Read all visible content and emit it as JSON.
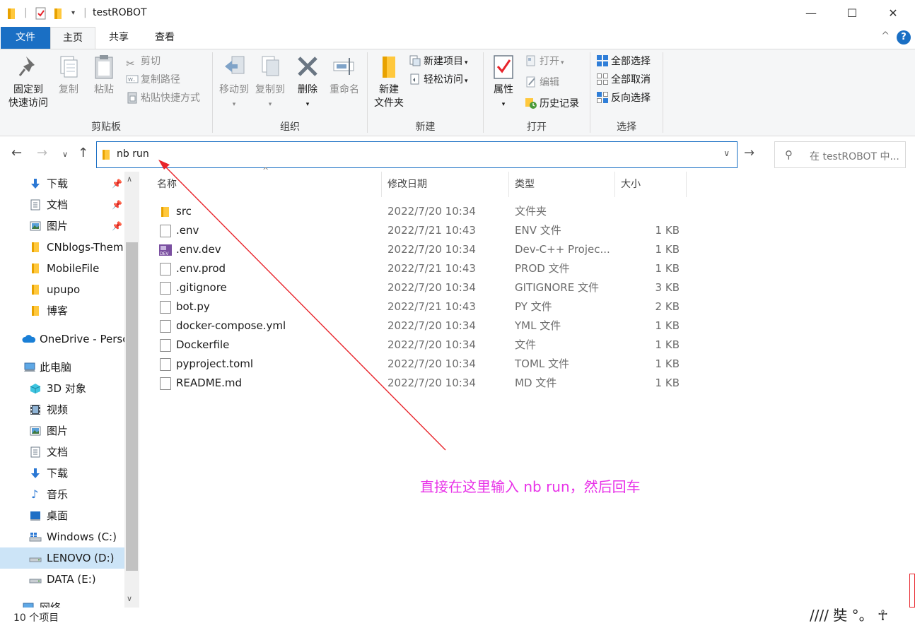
{
  "window": {
    "title": "testROBOT",
    "minimize_glyph": "—",
    "maximize_glyph": "☐",
    "close_glyph": "✕"
  },
  "tabs": [
    {
      "label": "文件"
    },
    {
      "label": "主页"
    },
    {
      "label": "共享"
    },
    {
      "label": "查看"
    }
  ],
  "help_glyph": "?",
  "collapse_glyph": "^",
  "ribbon": {
    "clipboard": {
      "label": "剪贴板",
      "pin_line1": "固定到",
      "pin_line2": "快速访问",
      "copy": "复制",
      "paste": "粘贴",
      "cut": "剪切",
      "copy_path": "复制路径",
      "paste_shortcut": "粘贴快捷方式"
    },
    "organize": {
      "label": "组织",
      "move_to": "移动到",
      "copy_to": "复制到",
      "delete": "删除",
      "rename": "重命名"
    },
    "new": {
      "label": "新建",
      "new_folder_line1": "新建",
      "new_folder_line2": "文件夹",
      "new_item": "新建项目",
      "easy_access": "轻松访问"
    },
    "open": {
      "label": "打开",
      "properties": "属性",
      "open": "打开",
      "edit": "编辑",
      "history": "历史记录"
    },
    "select": {
      "label": "选择",
      "select_all": "全部选择",
      "select_none": "全部取消",
      "invert": "反向选择"
    }
  },
  "address": {
    "path": "nb run",
    "search_placeholder": "在 testROBOT 中..."
  },
  "nav": {
    "items": [
      {
        "label": "下载",
        "pinned": true,
        "icon": "download-icon"
      },
      {
        "label": "文档",
        "pinned": true,
        "icon": "document-icon"
      },
      {
        "label": "图片",
        "pinned": true,
        "icon": "picture-icon"
      },
      {
        "label": "CNblogs-Them",
        "pinned": false,
        "icon": "folder-icon"
      },
      {
        "label": "MobileFile",
        "pinned": false,
        "icon": "folder-icon"
      },
      {
        "label": "upupo",
        "pinned": false,
        "icon": "folder-icon"
      },
      {
        "label": "博客",
        "pinned": false,
        "icon": "folder-icon"
      },
      {
        "label": "OneDrive - Perso",
        "pinned": false,
        "icon": "cloud-icon"
      },
      {
        "label": "此电脑",
        "pinned": false,
        "icon": "computer-icon"
      },
      {
        "label": "3D 对象",
        "pinned": false,
        "icon": "3d-objects-icon"
      },
      {
        "label": "视频",
        "pinned": false,
        "icon": "video-icon"
      },
      {
        "label": "图片",
        "pinned": false,
        "icon": "picture-icon"
      },
      {
        "label": "文档",
        "pinned": false,
        "icon": "document-icon"
      },
      {
        "label": "下载",
        "pinned": false,
        "icon": "download-icon"
      },
      {
        "label": "音乐",
        "pinned": false,
        "icon": "music-icon"
      },
      {
        "label": "桌面",
        "pinned": false,
        "icon": "desktop-icon"
      },
      {
        "label": "Windows (C:)",
        "pinned": false,
        "icon": "drive-icon"
      },
      {
        "label": "LENOVO (D:)",
        "pinned": false,
        "icon": "drive-icon",
        "selected": true
      },
      {
        "label": "DATA (E:)",
        "pinned": false,
        "icon": "drive-icon"
      },
      {
        "label": "网络",
        "pinned": false,
        "icon": "network-icon"
      }
    ],
    "pin_glyph": "📌"
  },
  "columns": {
    "name": "名称",
    "date": "修改日期",
    "type": "类型",
    "size": "大小"
  },
  "files": [
    {
      "name": "src",
      "date": "2022/7/20 10:34",
      "type": "文件夹",
      "size": "",
      "icon": "folder-icon"
    },
    {
      "name": ".env",
      "date": "2022/7/21 10:43",
      "type": "ENV 文件",
      "size": "1 KB",
      "icon": "file-icon"
    },
    {
      "name": ".env.dev",
      "date": "2022/7/20 10:34",
      "type": "Dev-C++ Projec...",
      "size": "1 KB",
      "icon": "dev-cpp-project-icon"
    },
    {
      "name": ".env.prod",
      "date": "2022/7/21 10:43",
      "type": "PROD 文件",
      "size": "1 KB",
      "icon": "file-icon"
    },
    {
      "name": ".gitignore",
      "date": "2022/7/20 10:34",
      "type": "GITIGNORE 文件",
      "size": "3 KB",
      "icon": "file-icon"
    },
    {
      "name": "bot.py",
      "date": "2022/7/21 10:43",
      "type": "PY 文件",
      "size": "2 KB",
      "icon": "file-icon"
    },
    {
      "name": "docker-compose.yml",
      "date": "2022/7/20 10:34",
      "type": "YML 文件",
      "size": "1 KB",
      "icon": "file-icon"
    },
    {
      "name": "Dockerfile",
      "date": "2022/7/20 10:34",
      "type": "文件",
      "size": "1 KB",
      "icon": "file-icon"
    },
    {
      "name": "pyproject.toml",
      "date": "2022/7/20 10:34",
      "type": "TOML 文件",
      "size": "1 KB",
      "icon": "file-icon"
    },
    {
      "name": "README.md",
      "date": "2022/7/20 10:34",
      "type": "MD 文件",
      "size": "1 KB",
      "icon": "file-icon"
    }
  ],
  "status": "10 个项目",
  "annotation": "直接在这里输入 nb run，然后回车",
  "watermark": "//// 奘 °。 ☥",
  "colors": {
    "accent": "#1a6fc4",
    "annotation": "#e832e8",
    "arrow": "#e8242b",
    "folder": "#ffc83d",
    "selection": "#cce4f7"
  }
}
